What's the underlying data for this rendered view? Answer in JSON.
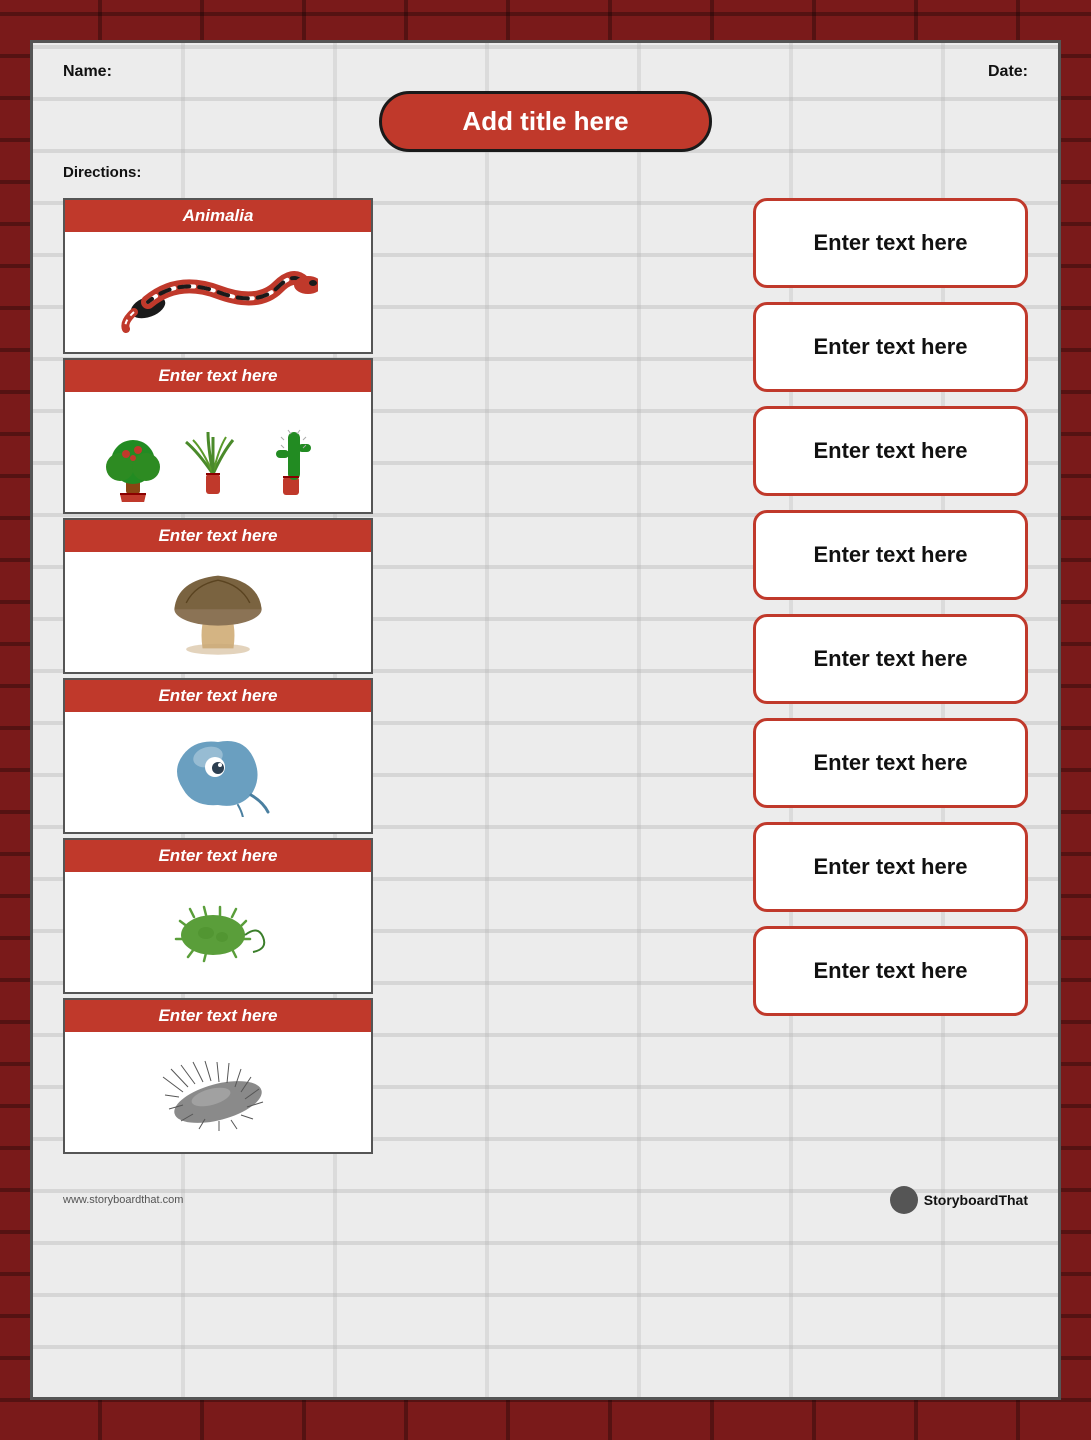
{
  "header": {
    "name_label": "Name:",
    "date_label": "Date:"
  },
  "title": "Add title here",
  "directions_label": "Directions:",
  "cards": [
    {
      "id": "card-1",
      "header": "Animalia",
      "type": "snake"
    },
    {
      "id": "card-2",
      "header": "Enter text here",
      "type": "plants"
    },
    {
      "id": "card-3",
      "header": "Enter text here",
      "type": "mushroom"
    },
    {
      "id": "card-4",
      "header": "Enter text here",
      "type": "blob"
    },
    {
      "id": "card-5",
      "header": "Enter text here",
      "type": "bacteria"
    },
    {
      "id": "card-6",
      "header": "Enter text here",
      "type": "microbe"
    }
  ],
  "text_boxes": [
    "Enter text here",
    "Enter text here",
    "Enter text here",
    "Enter text here",
    "Enter text here",
    "Enter text here",
    "Enter text here",
    "Enter text here"
  ],
  "footer": {
    "left": "www.storyboardthat.com",
    "right": "StoryboardThat"
  }
}
